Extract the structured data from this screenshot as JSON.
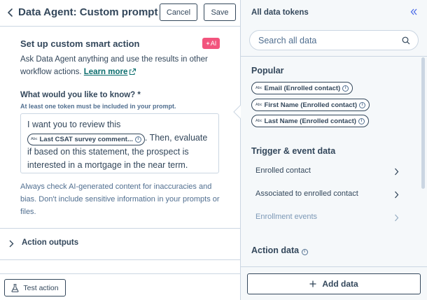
{
  "header": {
    "title": "Data Agent: Custom prompt",
    "cancel_label": "Cancel",
    "save_label": "Save"
  },
  "main": {
    "section_title": "Set up custom smart action",
    "ai_badge": "AI",
    "description": "Ask Data Agent anything and use the results in other workflow actions.",
    "learn_more": "Learn more",
    "question_label": "What would you like to know? *",
    "question_hint": "At least one token must be included in your prompt.",
    "prompt": {
      "before": "I want you to review this",
      "token_type": "Abc",
      "token_label": "Last CSAT survey comment...",
      "after": ". Then, evaluate if based on this statement, the prospect is interested in a mortgage in the near term."
    },
    "disclaimer": "Always check AI-generated content for inaccuracies and bias. Don't include sensitive information in your prompts or files.",
    "action_outputs": "Action outputs",
    "test_action_label": "Test action"
  },
  "panel": {
    "title": "All data tokens",
    "search_placeholder": "Search all data",
    "popular_heading": "Popular",
    "popular_tokens": [
      {
        "type": "Abc",
        "label": "Email (Enrolled contact)"
      },
      {
        "type": "Abc",
        "label": "First Name (Enrolled contact)"
      },
      {
        "type": "Abc",
        "label": "Last Name (Enrolled contact)"
      }
    ],
    "trigger_heading": "Trigger & event data",
    "trigger_items": [
      {
        "label": "Enrolled contact"
      },
      {
        "label": "Associated to enrolled contact"
      },
      {
        "label": "Enrollment events"
      }
    ],
    "action_heading": "Action data",
    "add_data_label": "Add data"
  },
  "colors": {
    "text": "#33475b",
    "ai_badge": "#f2547d",
    "link": "#0b6d6d",
    "border": "#cbd6e2",
    "panel_bg": "#f5f8fa"
  }
}
